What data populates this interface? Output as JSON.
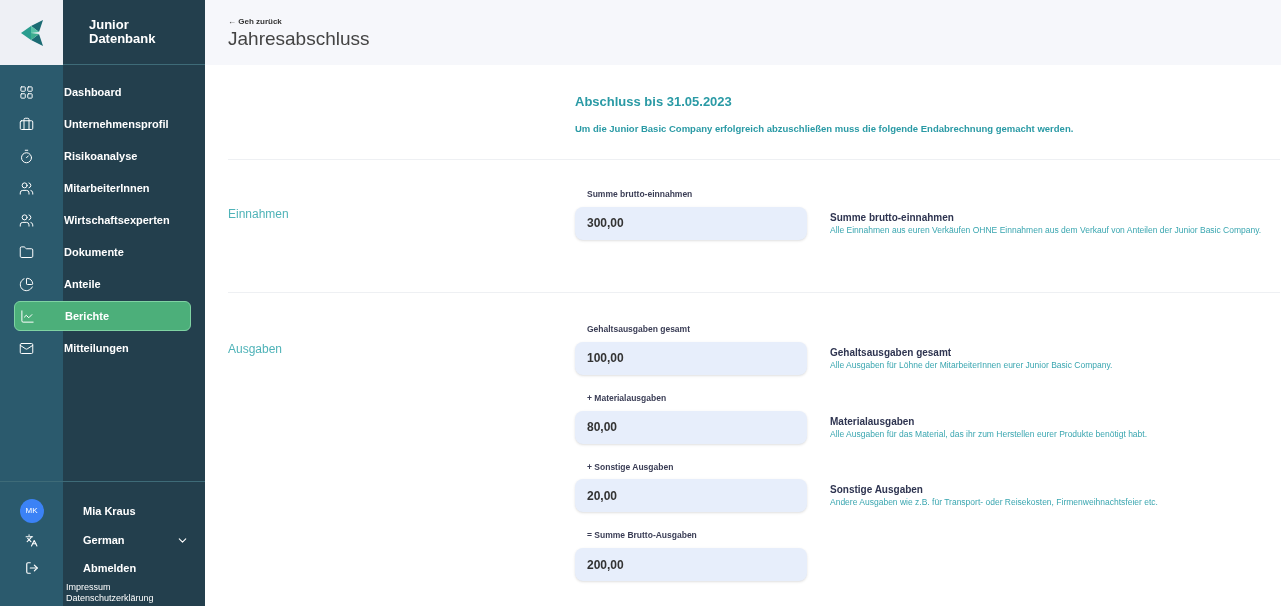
{
  "brand": {
    "line1": "Junior",
    "line2": "Datenbank"
  },
  "nav": [
    {
      "label": "Dashboard",
      "selected": false
    },
    {
      "label": "Unternehmensprofil",
      "selected": false
    },
    {
      "label": "Risikoanalyse",
      "selected": false
    },
    {
      "label": "MitarbeiterInnen",
      "selected": false
    },
    {
      "label": "Wirtschaftsexperten",
      "selected": false
    },
    {
      "label": "Dokumente",
      "selected": false
    },
    {
      "label": "Anteile",
      "selected": false
    },
    {
      "label": "Berichte",
      "selected": true
    },
    {
      "label": "Mitteilungen",
      "selected": false
    }
  ],
  "user": {
    "initials": "MK",
    "name": "Mia Kraus"
  },
  "language": "German",
  "logout": "Abmelden",
  "footer_links": [
    "Impressum",
    "Datenschutzerklärung"
  ],
  "header": {
    "back": "← Geh zurück",
    "title": "Jahresabschluss"
  },
  "intro": {
    "title": "Abschluss bis 31.05.2023",
    "text": "Um die Junior Basic Company erfolgreich abzuschließen muss die folgende Endabrechnung gemacht werden."
  },
  "sections": [
    {
      "title": "Einnahmen",
      "fields": [
        {
          "label": "Summe brutto-einnahmen",
          "value": "300,00",
          "help_title": "Summe brutto-einnahmen",
          "help_text": "Alle Einnahmen aus euren Verkäufen OHNE Einnahmen aus dem Verkauf von Anteilen der Junior Basic Company."
        }
      ]
    },
    {
      "title": "Ausgaben",
      "fields": [
        {
          "label": "Gehaltsausgaben gesamt",
          "value": "100,00",
          "help_title": "Gehaltsausgaben gesamt",
          "help_text": "Alle Ausgaben für Löhne der MitarbeiterInnen eurer Junior Basic Company."
        },
        {
          "label": "+ Materialausgaben",
          "value": "80,00",
          "help_title": "Materialausgaben",
          "help_text": "Alle Ausgaben für das Material, das ihr zum Herstellen eurer Produkte benötigt habt."
        },
        {
          "label": "+ Sonstige Ausgaben",
          "value": "20,00",
          "help_title": "Sonstige Ausgaben",
          "help_text": "Andere Ausgaben wie z.B. für Transport- oder Reisekosten, Firmenweihnachtsfeier etc."
        },
        {
          "label": "= Summe Brutto-Ausgaben",
          "value": "200,00"
        }
      ]
    }
  ]
}
